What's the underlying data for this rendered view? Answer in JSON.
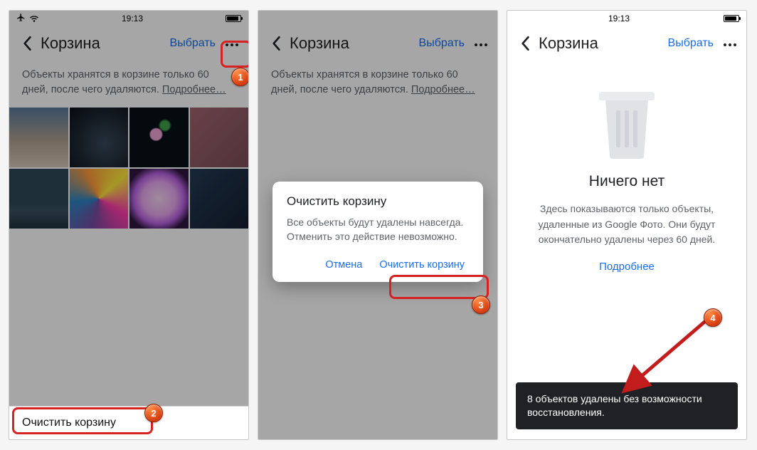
{
  "statusbar": {
    "time": "19:13"
  },
  "nav": {
    "title": "Корзина",
    "select": "Выбрать"
  },
  "info": {
    "text": "Объекты хранятся в корзине только 60 дней, после чего удаляются.",
    "link": "Подробнее…"
  },
  "sheet": {
    "empty_trash": "Очистить корзину"
  },
  "dialog": {
    "title": "Очистить корзину",
    "body": "Все объекты будут удалены навсегда. Отменить это действие невозможно.",
    "cancel": "Отмена",
    "confirm": "Очистить корзину"
  },
  "empty": {
    "title": "Ничего нет",
    "desc": "Здесь показываются только объекты, удаленные из Google Фото. Они будут окончательно удалены через 60 дней.",
    "link": "Подробнее"
  },
  "toast": {
    "text": "8 объектов удалены без возможности восстановления."
  },
  "callouts": {
    "c1": "1",
    "c2": "2",
    "c3": "3",
    "c4": "4"
  }
}
